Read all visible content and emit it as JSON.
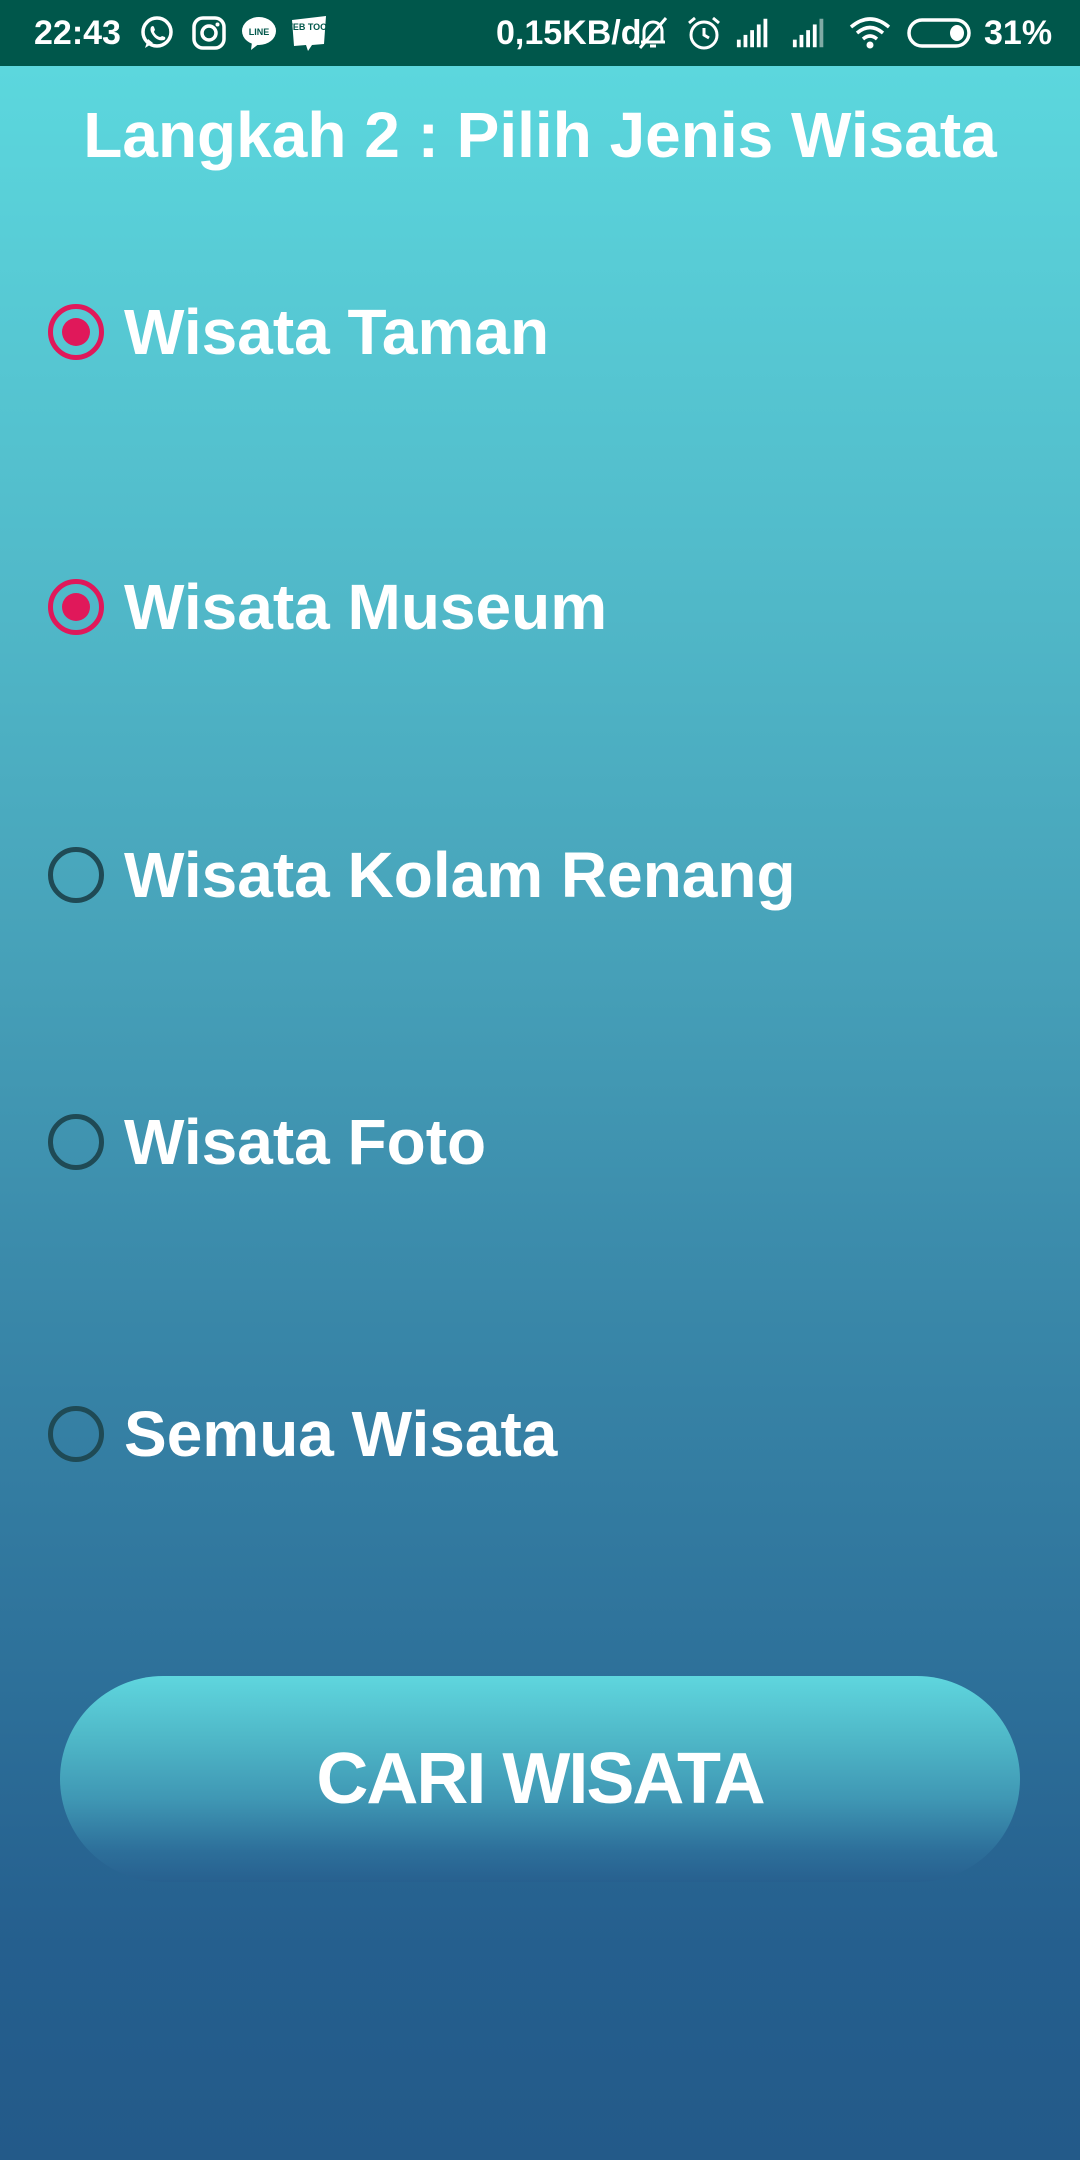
{
  "status_bar": {
    "time": "22:43",
    "network_speed": "0,15KB/d",
    "battery_percent": "31%",
    "notification_icons": [
      "whatsapp-icon",
      "instagram-icon",
      "line-icon",
      "webtoon-icon"
    ],
    "system_icons": [
      "bell-muted-icon",
      "alarm-icon",
      "signal-icon",
      "signal-icon",
      "wifi-icon",
      "battery-icon"
    ],
    "line_icon_text": "LINE",
    "webtoon_icon_text": "WEB TOON"
  },
  "page": {
    "title": "Langkah 2 : Pilih Jenis Wisata"
  },
  "options": [
    {
      "label": "Wisata Taman",
      "checked": true
    },
    {
      "label": "Wisata Museum",
      "checked": true
    },
    {
      "label": "Wisata Kolam Renang",
      "checked": false
    },
    {
      "label": "Wisata Foto",
      "checked": false
    },
    {
      "label": "Semua Wisata",
      "checked": false
    }
  ],
  "search_button": {
    "label": "CARI WISATA"
  },
  "colors": {
    "status_bar_bg": "#00574b",
    "radio_checked": "#e0185a",
    "radio_unchecked": "#1f4a55",
    "background_top": "#5ddbe0",
    "background_bottom": "#235a89"
  }
}
